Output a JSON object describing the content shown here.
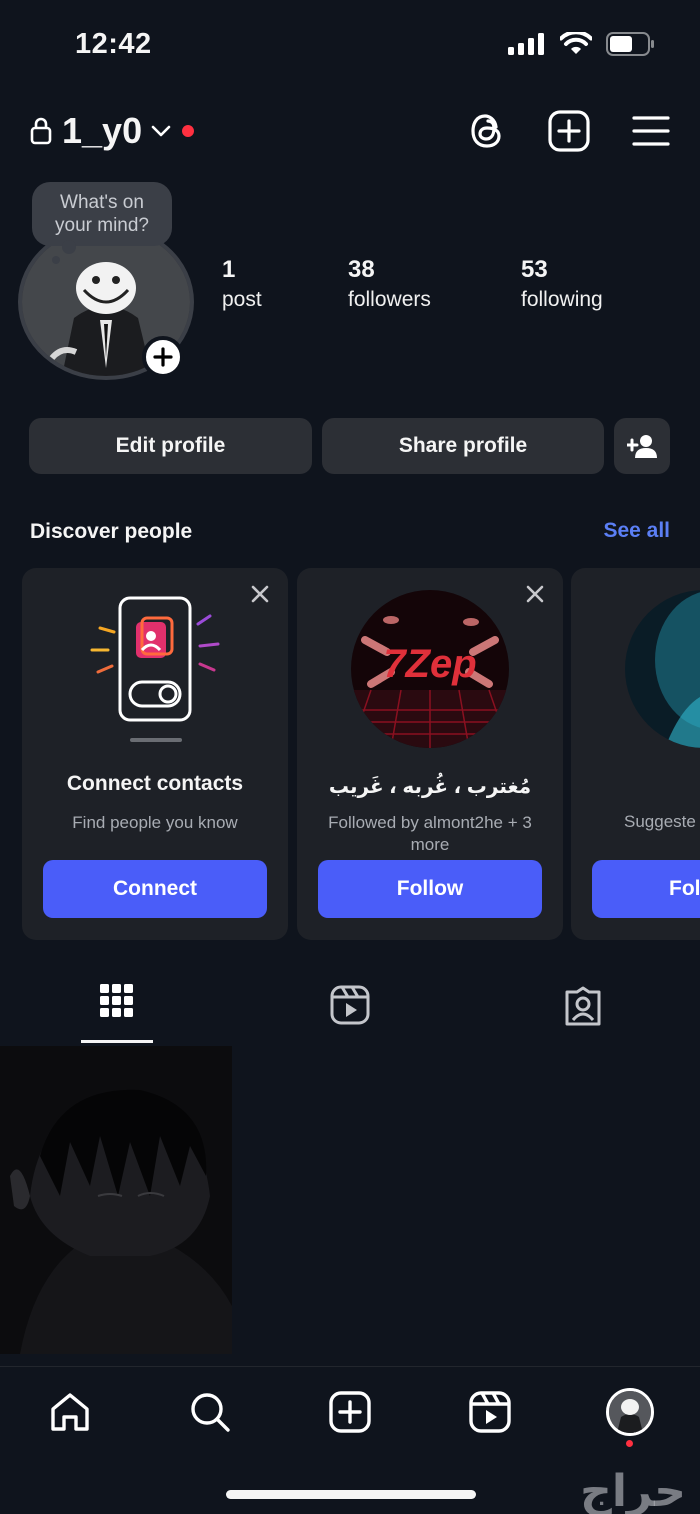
{
  "status": {
    "time": "12:42"
  },
  "header": {
    "username": "1_y0"
  },
  "profile": {
    "bubble_line1": "What's on",
    "bubble_line2": "your mind?",
    "stats": [
      {
        "num": "1",
        "label": "post"
      },
      {
        "num": "38",
        "label": "followers"
      },
      {
        "num": "53",
        "label": "following"
      }
    ],
    "edit_label": "Edit profile",
    "share_label": "Share profile"
  },
  "discover": {
    "title": "Discover people",
    "see_all": "See all",
    "cards": [
      {
        "title": "Connect contacts",
        "sub": "Find people you know",
        "button": "Connect"
      },
      {
        "title": "مُغترب ، غُربه ، غَريب",
        "sub": "Followed by almont2he + 3 more",
        "button": "Follow",
        "photo_text": "7Zep"
      },
      {
        "sub": "Suggeste",
        "button": "Fol"
      }
    ]
  },
  "watermark": "حراج",
  "colors": {
    "accent": "#4a5df9",
    "link": "#5b7ff5",
    "background": "#0f141d",
    "notification": "#ff3040"
  }
}
